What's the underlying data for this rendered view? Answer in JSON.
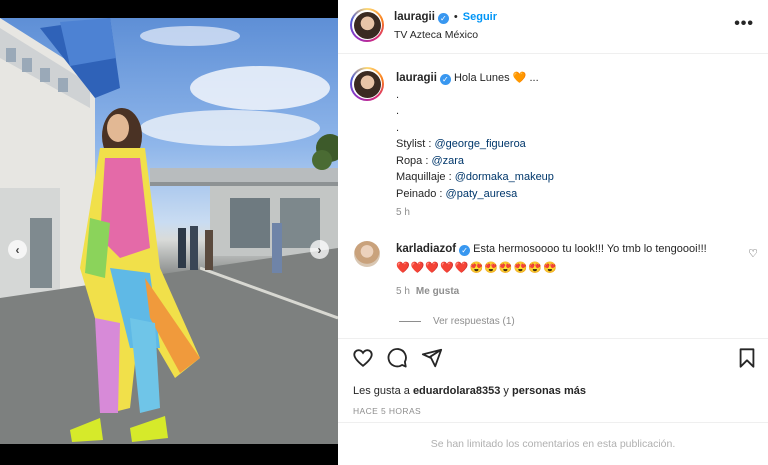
{
  "post": {
    "author": "lauragii",
    "follow_label": "Seguir",
    "separator": "•",
    "location": "TV Azteca México",
    "more_icon": "more-horizontal-icon"
  },
  "caption": {
    "author": "lauragii",
    "greeting": "Hola Lunes",
    "heart_emoji": "🧡",
    "ellipsis": "...",
    "dots": [
      ".",
      ".",
      "."
    ],
    "credits": [
      {
        "label": "Stylist : ",
        "handle": "@george_figueroa"
      },
      {
        "label": "Ropa : ",
        "handle": "@zara"
      },
      {
        "label": "Maquillaje : ",
        "handle": "@dormaka_makeup"
      },
      {
        "label": "Peinado : ",
        "handle": "@paty_auresa"
      }
    ],
    "time": "5 h"
  },
  "comment": {
    "author": "karladiazof",
    "text": "Esta hermosoooo tu look!!! Yo tmb lo tengoooi!!!",
    "emojis": "❤️❤️❤️❤️❤️😍😍😍😍😍😍",
    "time": "5 h",
    "like_label": "Me gusta",
    "replies_label": "Ver respuestas (1)"
  },
  "likes": {
    "prefix": "Les gusta a ",
    "user": "eduardolara8353",
    "middle": " y ",
    "rest": "personas más"
  },
  "posted_ago": "HACE 5 HORAS",
  "comments_limited": "Se han limitado los comentarios en esta publicación.",
  "colors": {
    "accent": "#0095f6",
    "verified": "#3897f0",
    "mention": "#00376b",
    "muted": "#8e8e8e"
  }
}
